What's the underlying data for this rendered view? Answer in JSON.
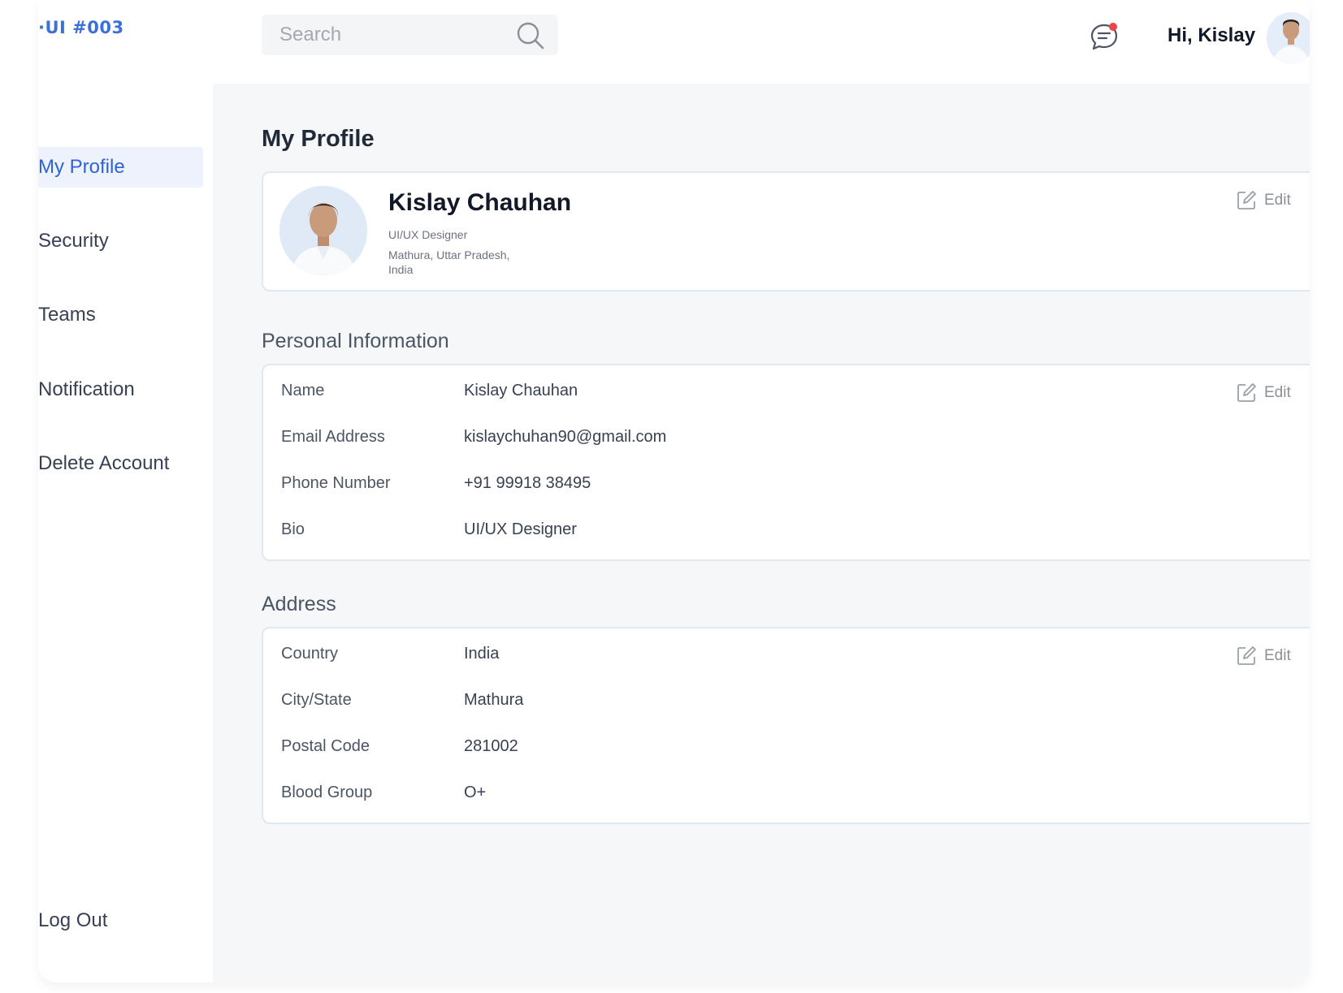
{
  "brand": "·UI #003",
  "search": {
    "placeholder": "Search"
  },
  "header": {
    "greeting": "Hi, Kislay"
  },
  "sidebar": {
    "items": [
      {
        "label": "My Profile",
        "active": true
      },
      {
        "label": "Security"
      },
      {
        "label": "Teams"
      },
      {
        "label": "Notification"
      },
      {
        "label": "Delete Account"
      }
    ],
    "logout_label": "Log Out"
  },
  "main": {
    "title": "My Profile",
    "profile": {
      "name": "Kislay Chauhan",
      "role": "UI/UX Designer",
      "location": "Mathura, Uttar Pradesh, India",
      "edit_label": "Edit"
    },
    "personal": {
      "title": "Personal Information",
      "edit_label": "Edit",
      "fields": [
        {
          "label": "Name",
          "value": "Kislay Chauhan"
        },
        {
          "label": "Email Address",
          "value": "kislaychuhan90@gmail.com"
        },
        {
          "label": "Phone Number",
          "value": "+91 99918 38495"
        },
        {
          "label": "Bio",
          "value": "UI/UX Designer"
        }
      ]
    },
    "address": {
      "title": "Address",
      "edit_label": "Edit",
      "fields": [
        {
          "label": "Country",
          "value": "India"
        },
        {
          "label": "City/State",
          "value": "Mathura"
        },
        {
          "label": "Postal Code",
          "value": "281002"
        },
        {
          "label": "Blood Group",
          "value": "O+"
        }
      ]
    }
  },
  "colors": {
    "accent": "#2f63d6",
    "active_bg": "#edf2fd",
    "notification_dot": "#ef4444",
    "card_border": "#dfe9f3",
    "main_bg": "#f5f7f9"
  },
  "icons": [
    "search-icon",
    "chat-notification-icon",
    "edit-icon",
    "avatar"
  ]
}
